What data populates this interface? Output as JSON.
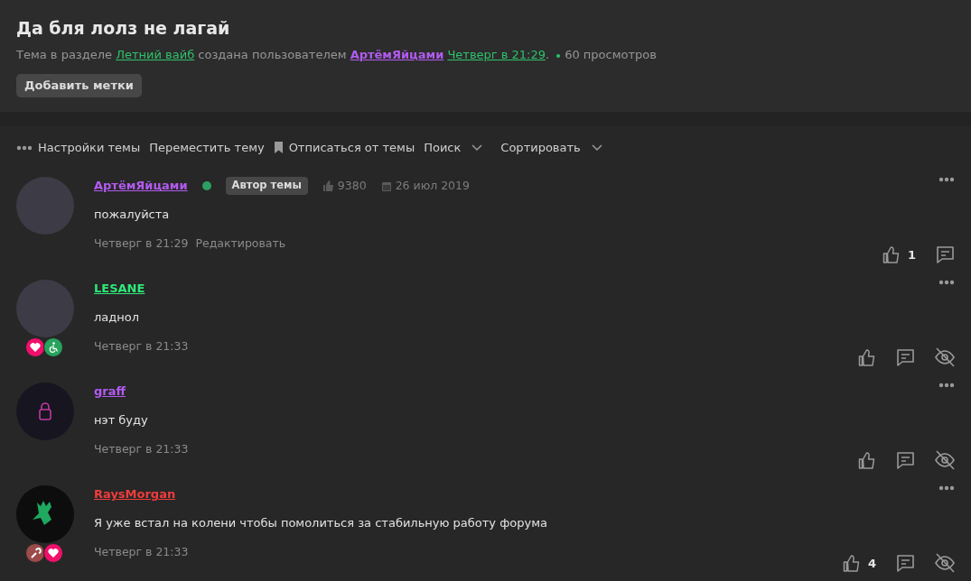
{
  "thread": {
    "title": "Да бля лолз не лагай",
    "meta": [
      {
        "kind": "plain",
        "text": "Тема в разделе"
      },
      {
        "kind": "link",
        "text": "Летний вайб"
      },
      {
        "kind": "plain",
        "text": "создана пользователем"
      },
      {
        "kind": "user",
        "text": "АртёмЯйцами"
      },
      {
        "kind": "link",
        "text": "Четверг в 21:29"
      },
      {
        "kind": "plain",
        "text": "."
      }
    ],
    "views": "60 просмотров",
    "tag_button": "Добавить метки"
  },
  "toolbar": [
    {
      "label": "Настройки темы",
      "kind": "menu",
      "dropdown": false
    },
    {
      "label": "Переместить тему",
      "kind": "plain",
      "dropdown": false
    },
    {
      "label": "Отписаться от темы",
      "kind": "bookmark",
      "dropdown": false
    },
    {
      "label": "Поиск",
      "kind": "plain",
      "dropdown": true
    },
    {
      "label": "Сортировать",
      "kind": "plain",
      "dropdown": true
    }
  ],
  "posts": [
    {
      "username": "АртёмЯйцами",
      "color": "#b25bf0",
      "kind": "photo",
      "online": true,
      "author_badge": "Автор темы",
      "likes_total": "9380",
      "joined": "26 июл 2019",
      "text": "пожалуйста",
      "time": "Четверг в 21:29",
      "edit": "Редактировать",
      "like_count": "1",
      "hide_button": false
    },
    {
      "username": "LESANE",
      "color": "#2ee87a",
      "kind": "photo",
      "badges": [
        {
          "kind": "heart",
          "color": "#f0106b"
        },
        {
          "kind": "wheelchair",
          "color": "#27a35c"
        }
      ],
      "online": false,
      "text": "ладнол",
      "time": "Четверг в 21:33",
      "hide_button": true
    },
    {
      "username": "graff",
      "color": "#b25bf0",
      "kind": "lock-logo",
      "online": false,
      "text": "нэт буду",
      "time": "Четверг в 21:33",
      "hide_button": true
    },
    {
      "username": "RaysMorgan",
      "color": "#f03c3c",
      "kind": "bird-logo",
      "badges": [
        {
          "kind": "wrench",
          "color": "#9c4b4b"
        },
        {
          "kind": "heart",
          "color": "#f0106b"
        }
      ],
      "online": false,
      "text": "Я уже встал на колени чтобы помолиться за стабильную работу форума",
      "time": "Четверг в 21:33",
      "like_count": "4",
      "hide_button": true
    }
  ]
}
